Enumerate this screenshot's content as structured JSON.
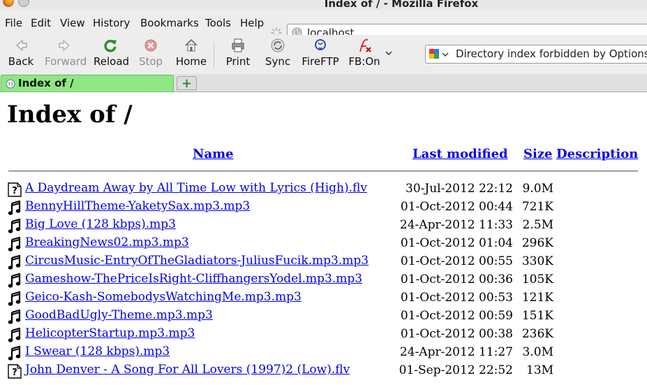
{
  "window": {
    "title": "Index of / - Mozilla Firefox"
  },
  "menu": [
    "File",
    "Edit",
    "View",
    "History",
    "Bookmarks",
    "Tools",
    "Help"
  ],
  "address": {
    "url": "localhost"
  },
  "toolbar": {
    "back": "Back",
    "forward": "Forward",
    "reload": "Reload",
    "stop": "Stop",
    "home": "Home",
    "print": "Print",
    "sync": "Sync",
    "fireftp": "FireFTP",
    "firebug": "FB:On"
  },
  "search": {
    "value": "Directory index forbidden by Options"
  },
  "tabs": [
    {
      "label": "Index of /"
    }
  ],
  "new_tab_label": "+",
  "page": {
    "heading": "Index of /",
    "columns": {
      "name": "Name",
      "modified": "Last modified",
      "size": "Size",
      "description": "Description"
    },
    "files": [
      {
        "name": "A Daydream Away by All Time Low with Lyrics (High).flv",
        "modified": "30-Jul-2012 22:12",
        "size": "9.0M",
        "type": "unknown"
      },
      {
        "name": "BennyHillTheme-YaketySax.mp3.mp3",
        "modified": "01-Oct-2012 00:44",
        "size": "721K",
        "type": "audio"
      },
      {
        "name": "Big Love (128 kbps).mp3",
        "modified": "24-Apr-2012 11:33",
        "size": "2.5M",
        "type": "audio"
      },
      {
        "name": "BreakingNews02.mp3.mp3",
        "modified": "01-Oct-2012 01:04",
        "size": "296K",
        "type": "audio"
      },
      {
        "name": "CircusMusic-EntryOfTheGladiators-JuliusFucik.mp3.mp3",
        "modified": "01-Oct-2012 00:55",
        "size": "330K",
        "type": "audio"
      },
      {
        "name": "Gameshow-ThePriceIsRight-CliffhangersYodel.mp3.mp3",
        "modified": "01-Oct-2012 00:36",
        "size": "105K",
        "type": "audio"
      },
      {
        "name": "Geico-Kash-SomebodysWatchingMe.mp3.mp3",
        "modified": "01-Oct-2012 00:53",
        "size": "121K",
        "type": "audio"
      },
      {
        "name": "GoodBadUgly-Theme.mp3.mp3",
        "modified": "01-Oct-2012 00:59",
        "size": "151K",
        "type": "audio"
      },
      {
        "name": "HelicopterStartup.mp3.mp3",
        "modified": "01-Oct-2012 00:38",
        "size": "236K",
        "type": "audio"
      },
      {
        "name": "I Swear (128 kbps).mp3",
        "modified": "24-Apr-2012 11:27",
        "size": "3.0M",
        "type": "audio"
      },
      {
        "name": "John Denver - A Song For All Lovers (1997)2 (Low).flv",
        "modified": "01-Sep-2012 22:52",
        "size": "13M",
        "type": "unknown"
      }
    ]
  }
}
